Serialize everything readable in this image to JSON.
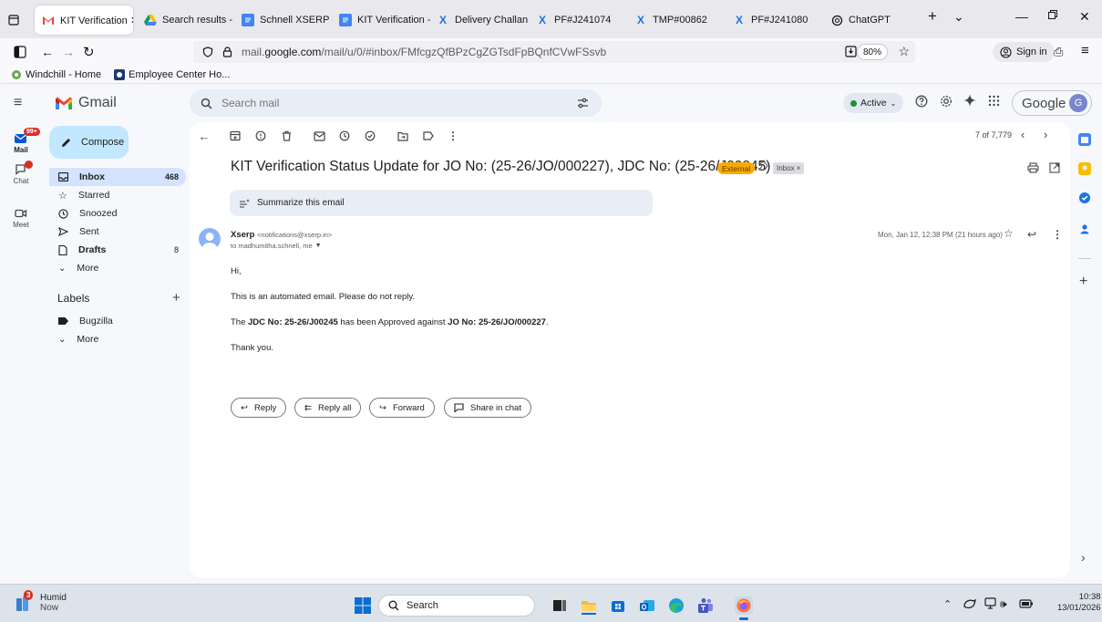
{
  "browser": {
    "tabs": [
      {
        "label": "KIT Verification ✕",
        "icon": "gmail-icon",
        "active": true
      },
      {
        "label": "Search results - G",
        "icon": "drive-icon"
      },
      {
        "label": "Schnell XSERP - K",
        "icon": "docs-icon"
      },
      {
        "label": "KIT Verification - |",
        "icon": "docs-icon"
      },
      {
        "label": "Delivery Challan",
        "icon": "x-icon"
      },
      {
        "label": "PF#J241074",
        "icon": "x-icon"
      },
      {
        "label": "TMP#00862",
        "icon": "x-icon"
      },
      {
        "label": "PF#J241080",
        "icon": "x-icon"
      },
      {
        "label": "ChatGPT",
        "icon": "chatgpt-icon"
      }
    ],
    "url_prefix": "mail.",
    "url_host": "google.com",
    "url_path": "/mail/u/0/#inbox/FMfcgzQfBPzCgZGTsdFpBQnfCVwFSsvb",
    "zoom": "80%",
    "sign_in": "Sign in",
    "bookmarks": [
      "Windchill - Home",
      "Employee Center Ho..."
    ]
  },
  "gmail": {
    "logo": "Gmail",
    "search_placeholder": "Search mail",
    "status": "Active",
    "account_brand": "Google",
    "account_initial": "G",
    "rail": {
      "mail_label": "Mail",
      "mail_badge": "99+",
      "chat_label": "Chat",
      "meet_label": "Meet"
    },
    "compose": "Compose",
    "nav": {
      "inbox": "Inbox",
      "inbox_count": "468",
      "starred": "Starred",
      "snoozed": "Snoozed",
      "sent": "Sent",
      "drafts": "Drafts",
      "drafts_count": "8",
      "more": "More"
    },
    "labels": {
      "title": "Labels",
      "add": "+",
      "items": [
        "Bugzilla"
      ],
      "more": "More"
    },
    "pager": "7 of 7,779",
    "email": {
      "subject": "KIT Verification Status Update for JO No: (25-26/JO/000227), JDC No: (25-26/J00245)",
      "external_badge": "External",
      "inbox_chip": "Inbox ×",
      "summarize": "Summarize this email",
      "sender_name": "Xserp",
      "sender_email": "<notifications@xserp.in>",
      "to": "to madhumitha.schnell, me",
      "date": "Mon, Jan 12, 12:38 PM (21 hours ago)",
      "greeting": "Hi,",
      "line1": "This is an automated email. Please do not reply.",
      "line2_pre": "The ",
      "line2_jdc": "JDC No: 25-26/J00245",
      "line2_mid": " has been Approved against ",
      "line2_jo": "JO No: 25-26/JO/000227",
      "line2_end": ".",
      "thanks": "Thank you."
    },
    "actions": {
      "reply": "Reply",
      "reply_all": "Reply all",
      "forward": "Forward",
      "share": "Share in chat"
    }
  },
  "taskbar": {
    "weather_badge": "3",
    "weather_title": "Humid",
    "weather_sub": "Now",
    "search": "Search",
    "time": "10:38",
    "date": "13/01/2026"
  },
  "colors": {
    "compose_bg": "#c2e7ff",
    "selected_nav": "#d3e3fd",
    "external_badge": "#f9ab00",
    "accent_blue": "#0b57d0"
  }
}
